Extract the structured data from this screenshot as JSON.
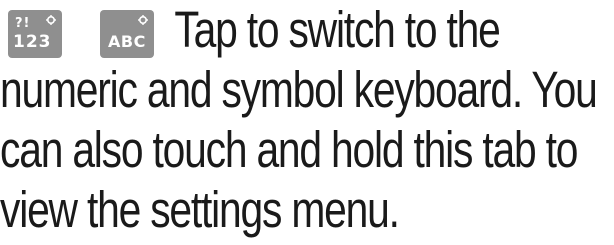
{
  "keys": {
    "numeric": {
      "top": "?!",
      "bottom": "123"
    },
    "abc": {
      "label": "ABC"
    }
  },
  "description": {
    "line1": "Tap to switch to the",
    "line2": "numeric and symbol keyboard. You",
    "line3": "can also touch and hold this tab to",
    "line4": "view the settings menu."
  },
  "colors": {
    "key_background": "#8f8f8f",
    "key_text": "#ffffff",
    "body_text": "#1a1a1a"
  }
}
